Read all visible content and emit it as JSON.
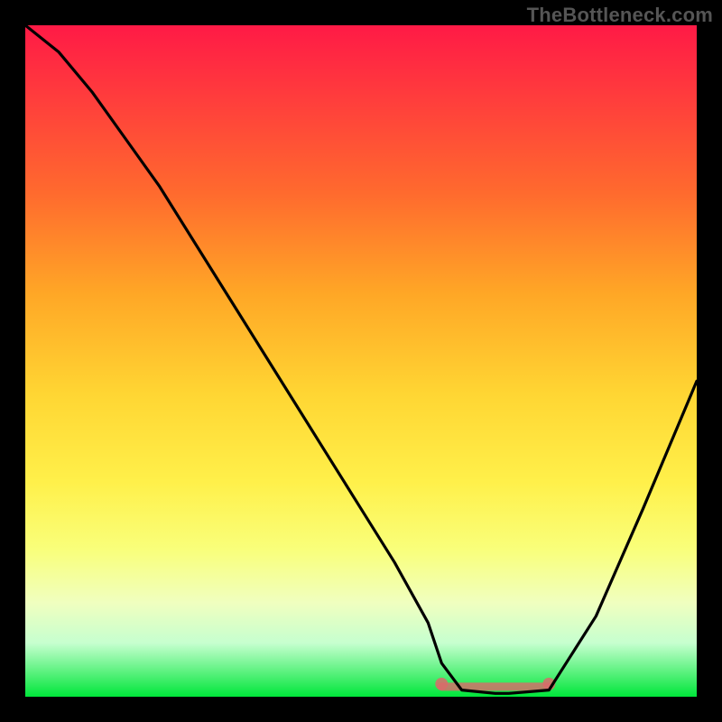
{
  "watermark": "TheBottleneck.com",
  "colors": {
    "frame": "#000000",
    "gradient_top": "#ff1a46",
    "gradient_mid": "#ffd633",
    "gradient_bottom": "#00e63a",
    "curve": "#000000",
    "valley_marker": "#d96b6b"
  },
  "chart_data": {
    "type": "line",
    "title": "",
    "xlabel": "",
    "ylabel": "",
    "xlim": [
      0,
      100
    ],
    "ylim": [
      0,
      100
    ],
    "x": [
      0,
      5,
      10,
      15,
      20,
      25,
      30,
      35,
      40,
      45,
      50,
      55,
      60,
      62,
      65,
      70,
      72,
      78,
      85,
      92,
      100
    ],
    "values": [
      100,
      96,
      90,
      83,
      76,
      68,
      60,
      52,
      44,
      36,
      28,
      20,
      11,
      5,
      1,
      0.5,
      0.5,
      1,
      12,
      28,
      47
    ],
    "valley_marker": {
      "x_start": 62,
      "x_end": 78,
      "y": 1.5
    },
    "annotations": []
  }
}
